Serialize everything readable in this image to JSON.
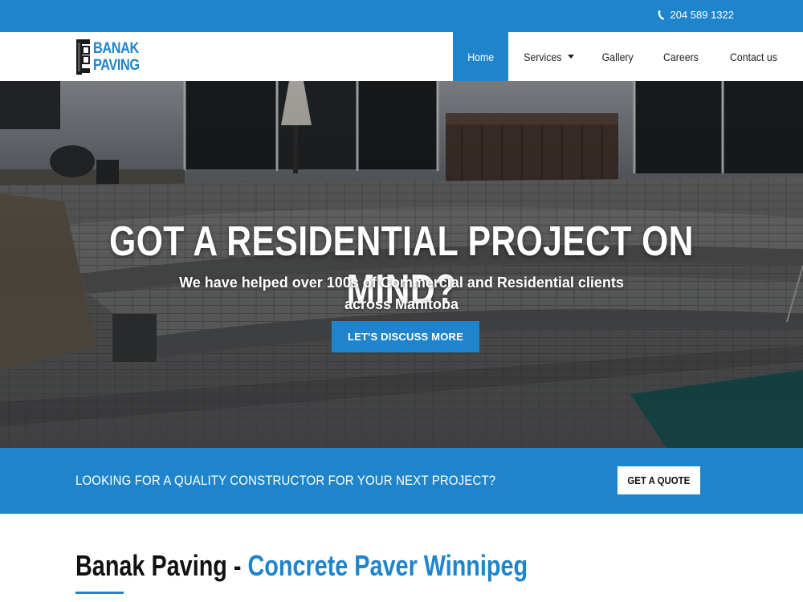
{
  "topbar": {
    "phone_icon": "phone-icon",
    "phone": "204 589 1322"
  },
  "logo": {
    "line1": "BANAK",
    "line2": "PAVING"
  },
  "nav": {
    "items": [
      {
        "label": "Home",
        "active": true
      },
      {
        "label": "Services",
        "dropdown": true
      },
      {
        "label": "Gallery"
      },
      {
        "label": "Careers"
      },
      {
        "label": "Contact us"
      }
    ]
  },
  "hero": {
    "title": "GOT A RESIDENTIAL PROJECT ON MIND?",
    "subtitle_line1": "We have helped over 100s of Commercial and Residential clients",
    "subtitle_line2": "across Manitoba",
    "button": "LET'S DISCUSS MORE"
  },
  "cta": {
    "text": "LOOKING FOR A QUALITY CONSTRUCTOR FOR YOUR NEXT PROJECT?",
    "button": "GET A QUOTE"
  },
  "section": {
    "title_dark": "Banak Paving - ",
    "title_blue": "Concrete Paver Winnipeg"
  },
  "colors": {
    "brand": "#1e84cc",
    "white": "#ffffff",
    "dark": "#111111"
  }
}
